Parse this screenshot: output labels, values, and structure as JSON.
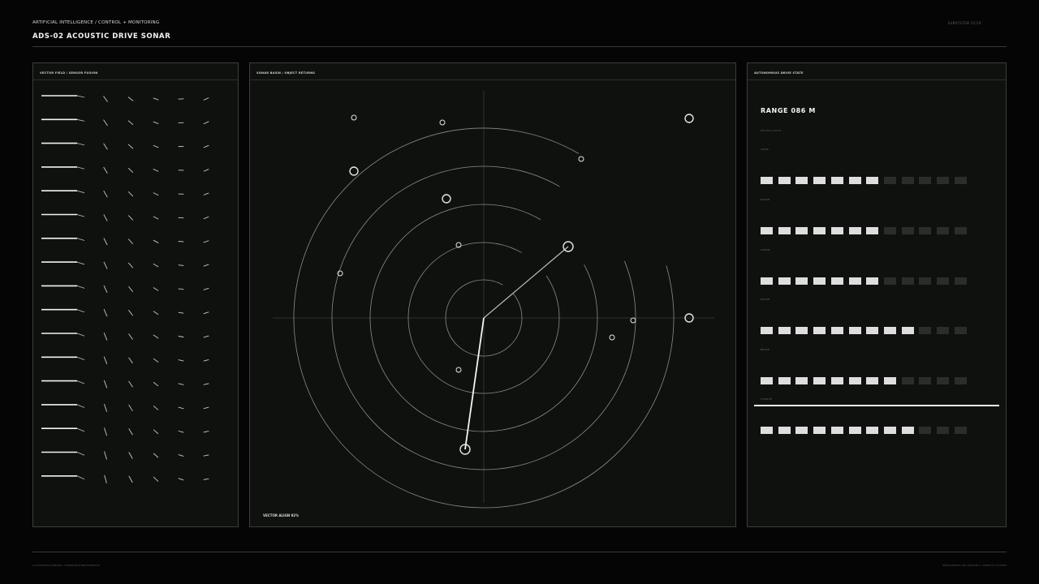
{
  "header": {
    "kicker": "ARTIFICIAL INTELLIGENCE / CONTROL + MONITORING",
    "title": "ADS-02  ACOUSTIC DRIVE SONAR",
    "subsystem": "SUBSYSTEM 01/18"
  },
  "panels": {
    "vector": {
      "title": "VECTOR FIELD / SENSOR FUSION"
    },
    "sonar": {
      "title": "SONAR BASIN / OBJECT RETURNS",
      "caption": "VECTOR ALIGN 92%"
    },
    "state": {
      "title": "AUTONOMOUS DRIVE STATE",
      "range": "RANGE 086 M",
      "range_sub": "HEADING 349.07",
      "meters": [
        {
          "label": "LIDAR",
          "value": 7,
          "total": 12
        },
        {
          "label": "RADAR",
          "value": 7,
          "total": 12
        },
        {
          "label": "VISION",
          "value": 7,
          "total": 12
        },
        {
          "label": "ROUTE",
          "value": 9,
          "total": 12
        },
        {
          "label": "BRAKE",
          "value": 8,
          "total": 12
        },
        {
          "label": "TORQUE",
          "value": 9,
          "total": 12
        }
      ]
    }
  },
  "footer": {
    "left": "AUTONOMOUS SENSING / HUMAN MACHINE INTERFACE",
    "right": "INTELLIGENCE LAB / MODULE 1 / MOBILITY SYSTEMS"
  },
  "colors": {
    "background": "#050505",
    "panel": "#0f110f",
    "accent": "#f0f0f0",
    "inactive": "#2b2d2b"
  }
}
